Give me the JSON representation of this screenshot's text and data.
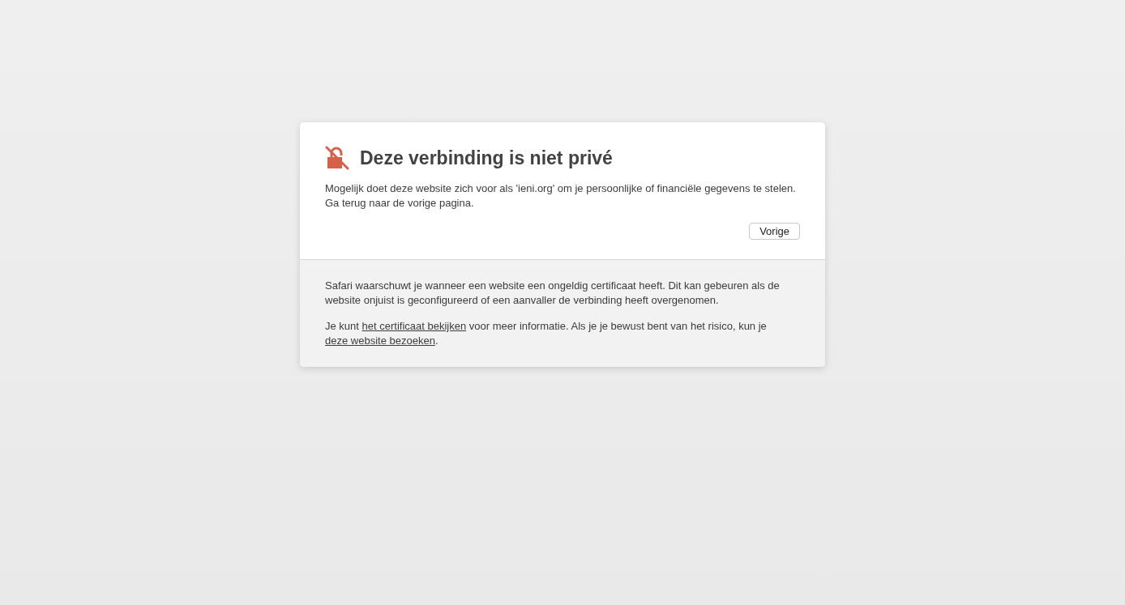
{
  "warning": {
    "title": "Deze verbinding is niet privé",
    "message": "Mogelijk doet deze website zich voor als 'ieni.org' om je persoonlijke of financiële gegevens te stelen. Ga terug naar de vorige pagina.",
    "back_button": "Vorige"
  },
  "details": {
    "explanation": "Safari waarschuwt je wanneer een website een ongeldig certificaat heeft. Dit kan gebeuren als de website onjuist is geconfigureerd of een aanvaller de verbinding heeft overgenomen.",
    "info": [
      {
        "kind": "text",
        "text": "Je kunt "
      },
      {
        "kind": "link",
        "text": "het certificaat bekijken"
      },
      {
        "kind": "text",
        "text": " voor meer informatie. Als je je bewust bent van het risico, kun je "
      },
      {
        "kind": "link",
        "text": "deze website bezoeken"
      },
      {
        "kind": "text",
        "text": "."
      }
    ]
  }
}
